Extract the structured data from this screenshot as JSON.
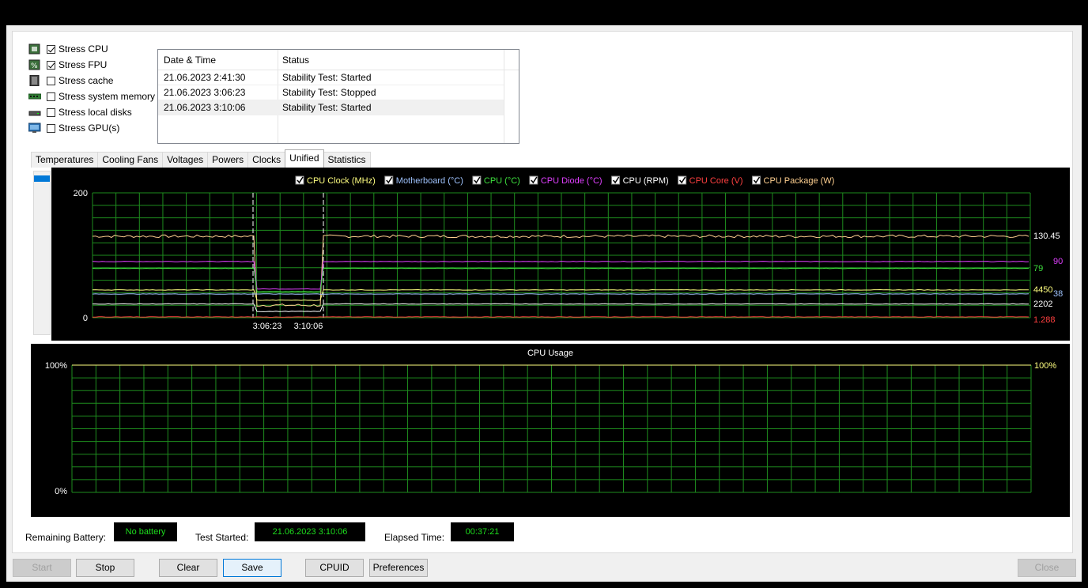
{
  "stress": [
    {
      "label": "Stress CPU",
      "checked": true,
      "icon": "cpu-icon"
    },
    {
      "label": "Stress FPU",
      "checked": true,
      "icon": "fpu-icon"
    },
    {
      "label": "Stress cache",
      "checked": false,
      "icon": "cache-icon"
    },
    {
      "label": "Stress system memory",
      "checked": false,
      "icon": "memory-icon"
    },
    {
      "label": "Stress local disks",
      "checked": false,
      "icon": "disk-icon"
    },
    {
      "label": "Stress GPU(s)",
      "checked": false,
      "icon": "gpu-icon"
    }
  ],
  "log": {
    "columns": [
      "Date & Time",
      "Status"
    ],
    "rows": [
      [
        "21.06.2023 2:41:30",
        "Stability Test: Started"
      ],
      [
        "21.06.2023 3:06:23",
        "Stability Test: Stopped"
      ],
      [
        "21.06.2023 3:10:06",
        "Stability Test: Started"
      ]
    ]
  },
  "tabs": [
    "Temperatures",
    "Cooling Fans",
    "Voltages",
    "Powers",
    "Clocks",
    "Unified",
    "Statistics"
  ],
  "active_tab": "Unified",
  "chart_data": [
    {
      "type": "line",
      "legend": [
        {
          "label": "CPU Clock (MHz)",
          "color": "#ffff80",
          "checked": true
        },
        {
          "label": "Motherboard (°C)",
          "color": "#a0c4ff",
          "checked": true
        },
        {
          "label": "CPU (°C)",
          "color": "#3ee03e",
          "checked": true
        },
        {
          "label": "CPU Diode (°C)",
          "color": "#e040ff",
          "checked": true
        },
        {
          "label": "CPU (RPM)",
          "color": "#ffffff",
          "checked": true
        },
        {
          "label": "CPU Core (V)",
          "color": "#ff4040",
          "checked": true
        },
        {
          "label": "CPU Package (W)",
          "color": "#ffd090",
          "checked": true
        }
      ],
      "y_axis": {
        "max_label": "200",
        "min_label": "0",
        "ylim": [
          0,
          200
        ]
      },
      "x_markers": [
        "3:06:23",
        "3:10:06"
      ],
      "right_labels": [
        {
          "text": "130.45",
          "color": "#ffffff"
        },
        {
          "text": "90",
          "color": "#e040ff"
        },
        {
          "text": "79",
          "color": "#3ee03e"
        },
        {
          "text": "4450",
          "color": "#ffff80"
        },
        {
          "text": "38",
          "color": "#a0c4ff"
        },
        {
          "text": "2202",
          "color": "#ffffff"
        },
        {
          "text": "1.288",
          "color": "#ff4040"
        }
      ],
      "series_levels": [
        {
          "name": "CPU Package (W)",
          "normal": 130.45,
          "stopped": 20
        },
        {
          "name": "CPU Diode (°C)",
          "normal": 90,
          "stopped": 46
        },
        {
          "name": "CPU (°C)",
          "normal": 79,
          "stopped": 42
        },
        {
          "name": "CPU Clock (MHz)",
          "normal": 44.5,
          "stopped": 28
        },
        {
          "name": "Motherboard (°C)",
          "normal": 38,
          "stopped": 38
        },
        {
          "name": "CPU (RPM)",
          "normal": 22,
          "stopped": 10
        },
        {
          "name": "CPU Core (V)",
          "normal": 1.3,
          "stopped": 1
        }
      ]
    },
    {
      "type": "line",
      "title": "CPU Usage",
      "y_axis": {
        "max_label": "100%",
        "min_label": "0%",
        "ylim": [
          0,
          100
        ]
      },
      "right_label": "100%",
      "values": [
        100
      ]
    }
  ],
  "status": {
    "battery_label": "Remaining Battery:",
    "battery_value": "No battery",
    "started_label": "Test Started:",
    "started_value": "21.06.2023 3:10:06",
    "elapsed_label": "Elapsed Time:",
    "elapsed_value": "00:37:21"
  },
  "buttons": {
    "start": "Start",
    "stop": "Stop",
    "clear": "Clear",
    "save": "Save",
    "cpuid": "CPUID",
    "preferences": "Preferences",
    "close": "Close"
  }
}
